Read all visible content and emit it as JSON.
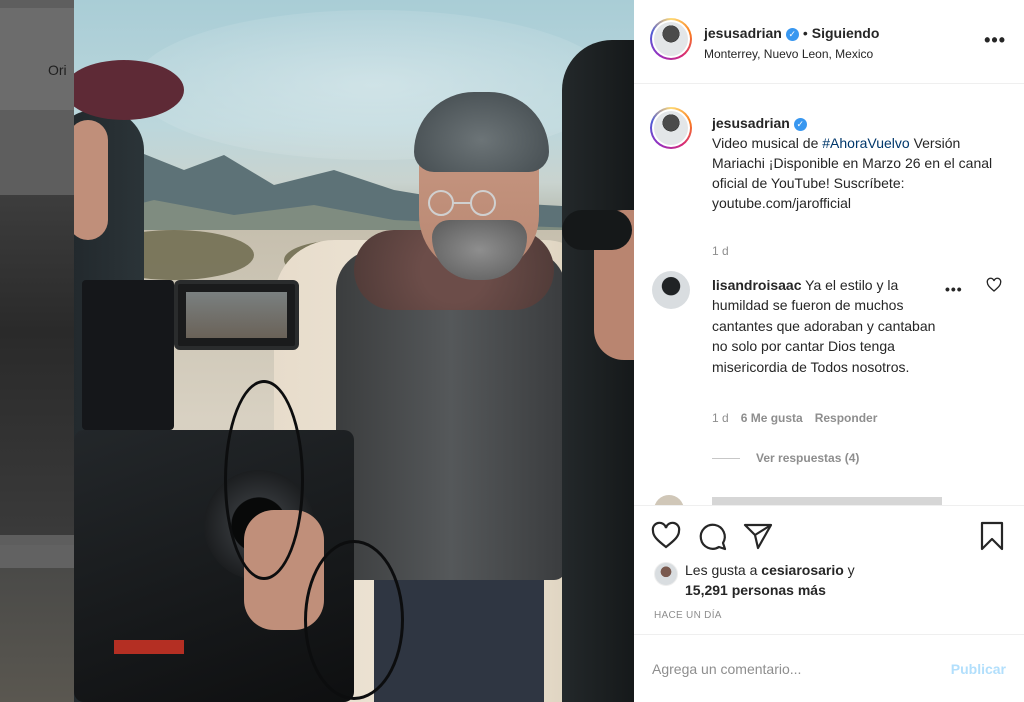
{
  "background": {
    "header_partial_text": "Ori"
  },
  "post": {
    "username": "jesusadrian",
    "verified_icon": "verified-badge-icon",
    "separator": "•",
    "follow_status": "Siguiendo",
    "location": "Monterrey, Nuevo Leon, Mexico",
    "more_icon": "more-options-icon",
    "more_glyph": "•••"
  },
  "caption": {
    "username": "jesusadrian",
    "text_prefix": "Video musical de ",
    "hashtag": "#AhoraVuelvo",
    "text_rest": " Versión Mariachi ¡Disponible en Marzo 26 en el canal oficial de YouTube! Suscríbete: youtube.com/jarofficial",
    "time": "1 d"
  },
  "comment": {
    "username": "lisandroisaac",
    "text": "Ya el estilo y la humildad se fueron de muchos cantantes que adoraban y cantaban no solo por cantar Dios tenga misericordia de Todos nosotros.",
    "time": "1 d",
    "likes": "6 Me gusta",
    "reply": "Responder",
    "more_glyph": "•••",
    "view_replies": "Ver respuestas (4)"
  },
  "actions": {
    "like_icon": "heart-icon",
    "comment_icon": "comment-icon",
    "share_icon": "paper-plane-icon",
    "save_icon": "bookmark-icon"
  },
  "likes": {
    "prefix": "Les gusta a ",
    "user": "cesiarosario",
    "suffix": " y ",
    "others": "15,291 personas más"
  },
  "posted_ago": "HACE UN DÍA",
  "add_comment": {
    "placeholder": "Agrega un comentario...",
    "publish_label": "Publicar"
  }
}
